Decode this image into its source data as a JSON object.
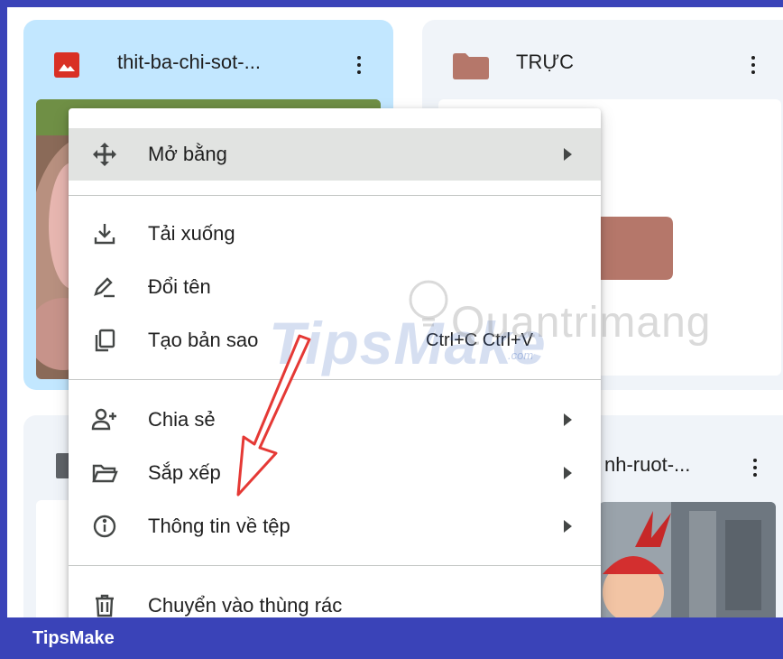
{
  "cards": {
    "file1": {
      "title": "thit-ba-chi-sot-..."
    },
    "folder": {
      "title": "TRỰC"
    },
    "file2": {
      "title": "nh-ruot-..."
    }
  },
  "menu": {
    "items": [
      {
        "label": "Mở bằng",
        "icon": "move-arrows-icon",
        "submenu": true
      },
      {
        "label": "Tải xuống",
        "icon": "download-icon"
      },
      {
        "label": "Đổi tên",
        "icon": "rename-pencil-icon"
      },
      {
        "label": "Tạo bản sao",
        "icon": "copy-icon",
        "shortcut": "Ctrl+C Ctrl+V"
      },
      {
        "label": "Chia sẻ",
        "icon": "share-person-icon",
        "submenu": true
      },
      {
        "label": "Sắp xếp",
        "icon": "folder-open-icon",
        "submenu": true
      },
      {
        "label": "Thông tin về tệp",
        "icon": "info-icon",
        "submenu": true
      },
      {
        "label": "Chuyển vào thùng rác",
        "icon": "trash-icon"
      }
    ]
  },
  "watermarks": {
    "tipsmake": "TipsMake",
    "tipsmake_small": ".com",
    "quantrimang": "Quantrimang"
  },
  "footer": {
    "brand": "TipsMake"
  },
  "colors": {
    "selected_card": "#c2e7ff",
    "card_bg": "#f0f4f9",
    "folder": "#b5776a",
    "image_icon": "#d93025",
    "frame_border": "#3a43b8",
    "arrow": "#e53935"
  }
}
